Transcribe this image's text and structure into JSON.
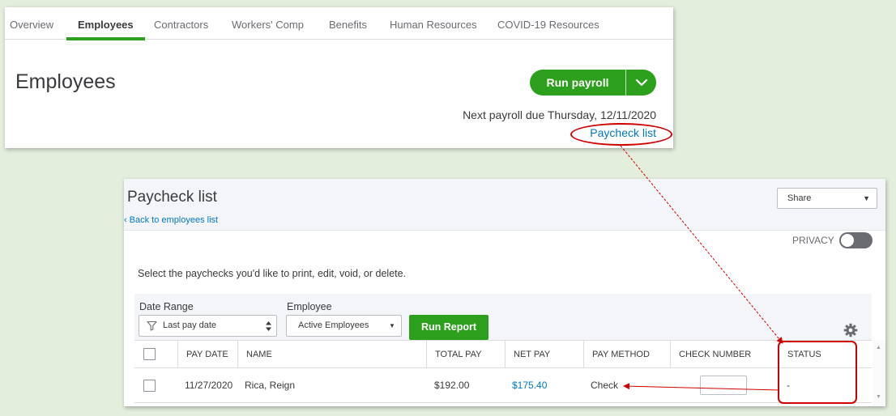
{
  "top": {
    "tabs": [
      {
        "label": "Overview"
      },
      {
        "label": "Employees"
      },
      {
        "label": "Contractors"
      },
      {
        "label": "Workers' Comp"
      },
      {
        "label": "Benefits"
      },
      {
        "label": "Human Resources"
      },
      {
        "label": "COVID-19 Resources"
      }
    ],
    "active_tab": "Employees",
    "page_title": "Employees",
    "run_payroll_label": "Run payroll",
    "next_payroll_text": "Next payroll due Thursday, 12/11/2020",
    "paycheck_list_link": "Paycheck list"
  },
  "paycheck": {
    "title": "Paycheck list",
    "back_link": "Back to employees list",
    "share_label": "Share",
    "privacy_label": "PRIVACY",
    "privacy_on": false,
    "instructions": "Select the paychecks you'd like to print, edit, void, or delete.",
    "date_range_label": "Date Range",
    "date_range_value": "Last pay date",
    "employee_label": "Employee",
    "employee_value": "Active Employees",
    "run_report_label": "Run Report",
    "columns": [
      "PAY DATE",
      "NAME",
      "TOTAL PAY",
      "NET PAY",
      "PAY METHOD",
      "CHECK NUMBER",
      "STATUS"
    ],
    "rows": [
      {
        "pay_date": "11/27/2020",
        "name": "Rica, Reign",
        "total_pay": "$192.00",
        "net_pay": "$175.40",
        "pay_method": "Check",
        "check_number": "",
        "status": "-"
      }
    ]
  },
  "colors": {
    "accent_green": "#2ca01c",
    "link_blue": "#0077c5",
    "annotation_red": "#d10000",
    "background": "#e4eedd"
  },
  "icons": [
    "chevron-down-icon",
    "chevron-left-icon",
    "filter-icon",
    "sort-arrows-icon",
    "caret-down-icon",
    "gear-icon",
    "scroll-up-icon",
    "scroll-down-icon"
  ]
}
